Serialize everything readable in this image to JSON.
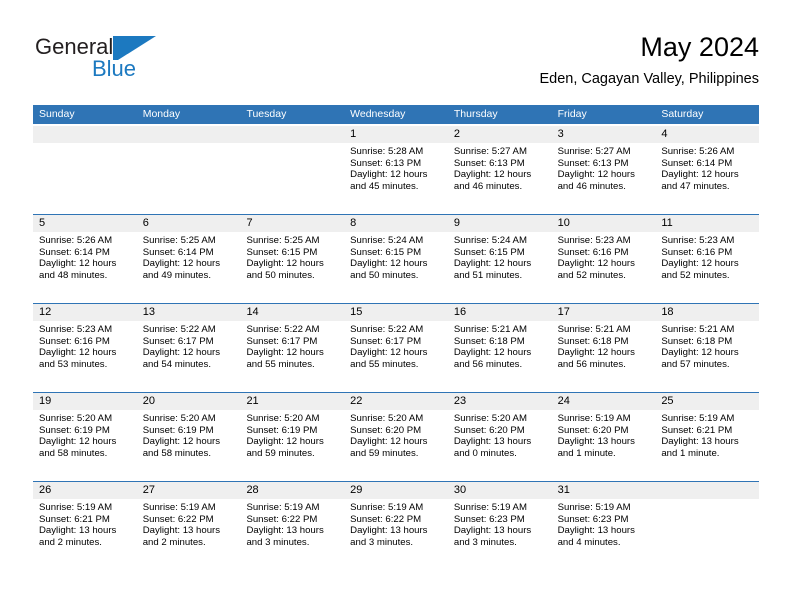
{
  "brand": {
    "name_part1": "General",
    "name_part2": "Blue",
    "logo_icon": "general-blue-triangle-logo",
    "accent_color": "#1c79c0"
  },
  "header": {
    "month_title": "May 2024",
    "location": "Eden, Cagayan Valley, Philippines"
  },
  "theme": {
    "header_blue": "#2f74b5",
    "day_band_gray": "#efefef",
    "text_color": "#000000"
  },
  "weekdays": [
    "Sunday",
    "Monday",
    "Tuesday",
    "Wednesday",
    "Thursday",
    "Friday",
    "Saturday"
  ],
  "weeks": [
    [
      {
        "day": "",
        "sunrise": "",
        "sunset": "",
        "daylight_line1": "",
        "daylight_line2": "",
        "empty": true
      },
      {
        "day": "",
        "sunrise": "",
        "sunset": "",
        "daylight_line1": "",
        "daylight_line2": "",
        "empty": true
      },
      {
        "day": "",
        "sunrise": "",
        "sunset": "",
        "daylight_line1": "",
        "daylight_line2": "",
        "empty": true
      },
      {
        "day": "1",
        "sunrise": "Sunrise: 5:28 AM",
        "sunset": "Sunset: 6:13 PM",
        "daylight_line1": "Daylight: 12 hours",
        "daylight_line2": "and 45 minutes."
      },
      {
        "day": "2",
        "sunrise": "Sunrise: 5:27 AM",
        "sunset": "Sunset: 6:13 PM",
        "daylight_line1": "Daylight: 12 hours",
        "daylight_line2": "and 46 minutes."
      },
      {
        "day": "3",
        "sunrise": "Sunrise: 5:27 AM",
        "sunset": "Sunset: 6:13 PM",
        "daylight_line1": "Daylight: 12 hours",
        "daylight_line2": "and 46 minutes."
      },
      {
        "day": "4",
        "sunrise": "Sunrise: 5:26 AM",
        "sunset": "Sunset: 6:14 PM",
        "daylight_line1": "Daylight: 12 hours",
        "daylight_line2": "and 47 minutes."
      }
    ],
    [
      {
        "day": "5",
        "sunrise": "Sunrise: 5:26 AM",
        "sunset": "Sunset: 6:14 PM",
        "daylight_line1": "Daylight: 12 hours",
        "daylight_line2": "and 48 minutes."
      },
      {
        "day": "6",
        "sunrise": "Sunrise: 5:25 AM",
        "sunset": "Sunset: 6:14 PM",
        "daylight_line1": "Daylight: 12 hours",
        "daylight_line2": "and 49 minutes."
      },
      {
        "day": "7",
        "sunrise": "Sunrise: 5:25 AM",
        "sunset": "Sunset: 6:15 PM",
        "daylight_line1": "Daylight: 12 hours",
        "daylight_line2": "and 50 minutes."
      },
      {
        "day": "8",
        "sunrise": "Sunrise: 5:24 AM",
        "sunset": "Sunset: 6:15 PM",
        "daylight_line1": "Daylight: 12 hours",
        "daylight_line2": "and 50 minutes."
      },
      {
        "day": "9",
        "sunrise": "Sunrise: 5:24 AM",
        "sunset": "Sunset: 6:15 PM",
        "daylight_line1": "Daylight: 12 hours",
        "daylight_line2": "and 51 minutes."
      },
      {
        "day": "10",
        "sunrise": "Sunrise: 5:23 AM",
        "sunset": "Sunset: 6:16 PM",
        "daylight_line1": "Daylight: 12 hours",
        "daylight_line2": "and 52 minutes."
      },
      {
        "day": "11",
        "sunrise": "Sunrise: 5:23 AM",
        "sunset": "Sunset: 6:16 PM",
        "daylight_line1": "Daylight: 12 hours",
        "daylight_line2": "and 52 minutes."
      }
    ],
    [
      {
        "day": "12",
        "sunrise": "Sunrise: 5:23 AM",
        "sunset": "Sunset: 6:16 PM",
        "daylight_line1": "Daylight: 12 hours",
        "daylight_line2": "and 53 minutes."
      },
      {
        "day": "13",
        "sunrise": "Sunrise: 5:22 AM",
        "sunset": "Sunset: 6:17 PM",
        "daylight_line1": "Daylight: 12 hours",
        "daylight_line2": "and 54 minutes."
      },
      {
        "day": "14",
        "sunrise": "Sunrise: 5:22 AM",
        "sunset": "Sunset: 6:17 PM",
        "daylight_line1": "Daylight: 12 hours",
        "daylight_line2": "and 55 minutes."
      },
      {
        "day": "15",
        "sunrise": "Sunrise: 5:22 AM",
        "sunset": "Sunset: 6:17 PM",
        "daylight_line1": "Daylight: 12 hours",
        "daylight_line2": "and 55 minutes."
      },
      {
        "day": "16",
        "sunrise": "Sunrise: 5:21 AM",
        "sunset": "Sunset: 6:18 PM",
        "daylight_line1": "Daylight: 12 hours",
        "daylight_line2": "and 56 minutes."
      },
      {
        "day": "17",
        "sunrise": "Sunrise: 5:21 AM",
        "sunset": "Sunset: 6:18 PM",
        "daylight_line1": "Daylight: 12 hours",
        "daylight_line2": "and 56 minutes."
      },
      {
        "day": "18",
        "sunrise": "Sunrise: 5:21 AM",
        "sunset": "Sunset: 6:18 PM",
        "daylight_line1": "Daylight: 12 hours",
        "daylight_line2": "and 57 minutes."
      }
    ],
    [
      {
        "day": "19",
        "sunrise": "Sunrise: 5:20 AM",
        "sunset": "Sunset: 6:19 PM",
        "daylight_line1": "Daylight: 12 hours",
        "daylight_line2": "and 58 minutes."
      },
      {
        "day": "20",
        "sunrise": "Sunrise: 5:20 AM",
        "sunset": "Sunset: 6:19 PM",
        "daylight_line1": "Daylight: 12 hours",
        "daylight_line2": "and 58 minutes."
      },
      {
        "day": "21",
        "sunrise": "Sunrise: 5:20 AM",
        "sunset": "Sunset: 6:19 PM",
        "daylight_line1": "Daylight: 12 hours",
        "daylight_line2": "and 59 minutes."
      },
      {
        "day": "22",
        "sunrise": "Sunrise: 5:20 AM",
        "sunset": "Sunset: 6:20 PM",
        "daylight_line1": "Daylight: 12 hours",
        "daylight_line2": "and 59 minutes."
      },
      {
        "day": "23",
        "sunrise": "Sunrise: 5:20 AM",
        "sunset": "Sunset: 6:20 PM",
        "daylight_line1": "Daylight: 13 hours",
        "daylight_line2": "and 0 minutes."
      },
      {
        "day": "24",
        "sunrise": "Sunrise: 5:19 AM",
        "sunset": "Sunset: 6:20 PM",
        "daylight_line1": "Daylight: 13 hours",
        "daylight_line2": "and 1 minute."
      },
      {
        "day": "25",
        "sunrise": "Sunrise: 5:19 AM",
        "sunset": "Sunset: 6:21 PM",
        "daylight_line1": "Daylight: 13 hours",
        "daylight_line2": "and 1 minute."
      }
    ],
    [
      {
        "day": "26",
        "sunrise": "Sunrise: 5:19 AM",
        "sunset": "Sunset: 6:21 PM",
        "daylight_line1": "Daylight: 13 hours",
        "daylight_line2": "and 2 minutes."
      },
      {
        "day": "27",
        "sunrise": "Sunrise: 5:19 AM",
        "sunset": "Sunset: 6:22 PM",
        "daylight_line1": "Daylight: 13 hours",
        "daylight_line2": "and 2 minutes."
      },
      {
        "day": "28",
        "sunrise": "Sunrise: 5:19 AM",
        "sunset": "Sunset: 6:22 PM",
        "daylight_line1": "Daylight: 13 hours",
        "daylight_line2": "and 3 minutes."
      },
      {
        "day": "29",
        "sunrise": "Sunrise: 5:19 AM",
        "sunset": "Sunset: 6:22 PM",
        "daylight_line1": "Daylight: 13 hours",
        "daylight_line2": "and 3 minutes."
      },
      {
        "day": "30",
        "sunrise": "Sunrise: 5:19 AM",
        "sunset": "Sunset: 6:23 PM",
        "daylight_line1": "Daylight: 13 hours",
        "daylight_line2": "and 3 minutes."
      },
      {
        "day": "31",
        "sunrise": "Sunrise: 5:19 AM",
        "sunset": "Sunset: 6:23 PM",
        "daylight_line1": "Daylight: 13 hours",
        "daylight_line2": "and 4 minutes."
      },
      {
        "day": "",
        "sunrise": "",
        "sunset": "",
        "daylight_line1": "",
        "daylight_line2": "",
        "empty": true
      }
    ]
  ]
}
